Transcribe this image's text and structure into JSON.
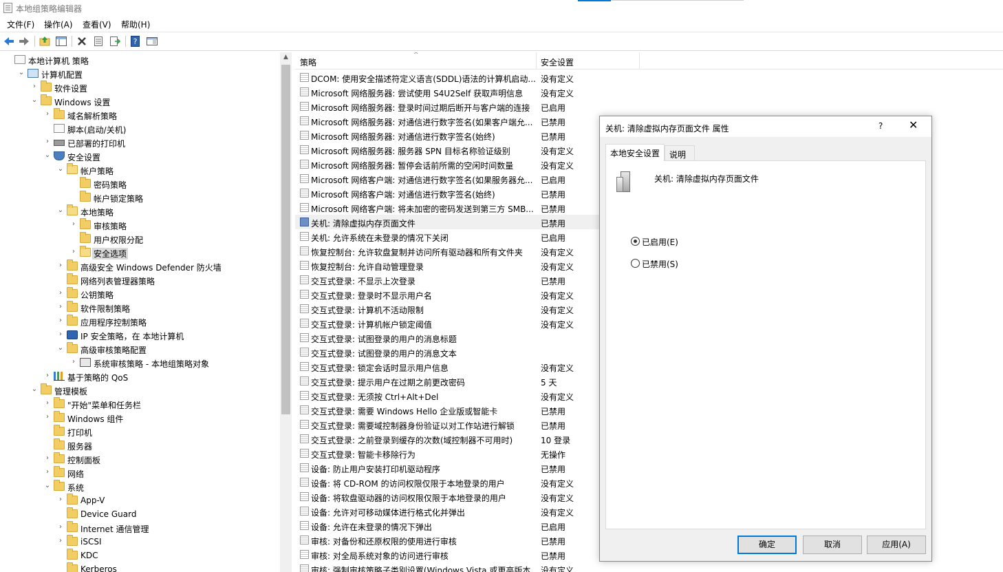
{
  "window": {
    "title": "本地组策略编辑器"
  },
  "menu": [
    "文件(F)",
    "操作(A)",
    "查看(V)",
    "帮助(H)"
  ],
  "toolbar": {
    "icons": [
      "back-icon",
      "forward-icon",
      "up-folder-icon",
      "show-hide-tree-icon",
      "delete-icon",
      "properties-icon",
      "export-list-icon",
      "help-icon",
      "view-icon"
    ]
  },
  "tree": {
    "items": [
      {
        "label": "本地计算机 策略",
        "level": 0,
        "icon": "doc",
        "toggle": ""
      },
      {
        "label": "计算机配置",
        "level": 1,
        "icon": "pc",
        "toggle": "v"
      },
      {
        "label": "软件设置",
        "level": 2,
        "icon": "folder",
        "toggle": ">"
      },
      {
        "label": "Windows 设置",
        "level": 2,
        "icon": "folder",
        "toggle": "v"
      },
      {
        "label": "域名解析策略",
        "level": 3,
        "icon": "folder",
        "toggle": ">"
      },
      {
        "label": "脚本(启动/关机)",
        "level": 3,
        "icon": "doc",
        "toggle": ""
      },
      {
        "label": "已部署的打印机",
        "level": 3,
        "icon": "printer",
        "toggle": ">"
      },
      {
        "label": "安全设置",
        "level": 3,
        "icon": "shield",
        "toggle": "v"
      },
      {
        "label": "帐户策略",
        "level": 4,
        "icon": "folder-open",
        "toggle": "v"
      },
      {
        "label": "密码策略",
        "level": 5,
        "icon": "folder",
        "toggle": ""
      },
      {
        "label": "帐户锁定策略",
        "level": 5,
        "icon": "folder",
        "toggle": ""
      },
      {
        "label": "本地策略",
        "level": 4,
        "icon": "folder-open",
        "toggle": "v"
      },
      {
        "label": "审核策略",
        "level": 5,
        "icon": "folder",
        "toggle": ">"
      },
      {
        "label": "用户权限分配",
        "level": 5,
        "icon": "folder",
        "toggle": ""
      },
      {
        "label": "安全选项",
        "level": 5,
        "icon": "folder-open",
        "toggle": ">",
        "selected": true
      },
      {
        "label": "高级安全 Windows Defender 防火墙",
        "level": 4,
        "icon": "folder",
        "toggle": ">"
      },
      {
        "label": "网络列表管理器策略",
        "level": 4,
        "icon": "folder",
        "toggle": ""
      },
      {
        "label": "公钥策略",
        "level": 4,
        "icon": "folder",
        "toggle": ">"
      },
      {
        "label": "软件限制策略",
        "level": 4,
        "icon": "folder",
        "toggle": ">"
      },
      {
        "label": "应用程序控制策略",
        "level": 4,
        "icon": "folder",
        "toggle": ">"
      },
      {
        "label": "IP 安全策略，在 本地计算机",
        "level": 4,
        "icon": "ip",
        "toggle": ">"
      },
      {
        "label": "高级审核策略配置",
        "level": 4,
        "icon": "folder",
        "toggle": "v"
      },
      {
        "label": "系统审核策略 - 本地组策略对象",
        "level": 5,
        "icon": "audit",
        "toggle": ">"
      },
      {
        "label": "基于策略的 QoS",
        "level": 3,
        "icon": "chart",
        "toggle": ">"
      },
      {
        "label": "管理模板",
        "level": 2,
        "icon": "folder",
        "toggle": "v"
      },
      {
        "label": "\"开始\"菜单和任务栏",
        "level": 3,
        "icon": "folder",
        "toggle": ">"
      },
      {
        "label": "Windows 组件",
        "level": 3,
        "icon": "folder",
        "toggle": ">"
      },
      {
        "label": "打印机",
        "level": 3,
        "icon": "folder",
        "toggle": ""
      },
      {
        "label": "服务器",
        "level": 3,
        "icon": "folder",
        "toggle": ""
      },
      {
        "label": "控制面板",
        "level": 3,
        "icon": "folder",
        "toggle": ">"
      },
      {
        "label": "网络",
        "level": 3,
        "icon": "folder",
        "toggle": ">"
      },
      {
        "label": "系统",
        "level": 3,
        "icon": "folder",
        "toggle": "v"
      },
      {
        "label": "App-V",
        "level": 4,
        "icon": "folder",
        "toggle": ">"
      },
      {
        "label": "Device Guard",
        "level": 4,
        "icon": "folder",
        "toggle": ""
      },
      {
        "label": "Internet 通信管理",
        "level": 4,
        "icon": "folder",
        "toggle": ">"
      },
      {
        "label": "iSCSI",
        "level": 4,
        "icon": "folder",
        "toggle": ">"
      },
      {
        "label": "KDC",
        "level": 4,
        "icon": "folder",
        "toggle": ""
      },
      {
        "label": "Kerberos",
        "level": 4,
        "icon": "folder",
        "toggle": ""
      }
    ]
  },
  "list": {
    "columns": [
      "策略",
      "安全设置"
    ],
    "rows": [
      {
        "name": "DCOM: 使用安全描述符定义语言(SDDL)语法的计算机启动...",
        "value": "没有定义"
      },
      {
        "name": "Microsoft 网络服务器: 尝试使用 S4U2Self 获取声明信息",
        "value": "没有定义"
      },
      {
        "name": "Microsoft 网络服务器: 登录时间过期后断开与客户端的连接",
        "value": "已启用"
      },
      {
        "name": "Microsoft 网络服务器: 对通信进行数字签名(如果客户端允...",
        "value": "已禁用"
      },
      {
        "name": "Microsoft 网络服务器: 对通信进行数字签名(始终)",
        "value": "已禁用"
      },
      {
        "name": "Microsoft 网络服务器: 服务器 SPN 目标名称验证级别",
        "value": "没有定义"
      },
      {
        "name": "Microsoft 网络服务器: 暂停会话前所需的空闲时间数量",
        "value": "没有定义"
      },
      {
        "name": "Microsoft 网络客户端: 对通信进行数字签名(如果服务器允...",
        "value": "已启用"
      },
      {
        "name": "Microsoft 网络客户端: 对通信进行数字签名(始终)",
        "value": "已禁用"
      },
      {
        "name": "Microsoft 网络客户端: 将未加密的密码发送到第三方 SMB...",
        "value": "已禁用"
      },
      {
        "name": "关机: 清除虚拟内存页面文件",
        "value": "已禁用",
        "highlight": true
      },
      {
        "name": "关机: 允许系统在未登录的情况下关闭",
        "value": "已启用"
      },
      {
        "name": "恢复控制台: 允许软盘复制并访问所有驱动器和所有文件夹",
        "value": "没有定义"
      },
      {
        "name": "恢复控制台: 允许自动管理登录",
        "value": "没有定义"
      },
      {
        "name": "交互式登录: 不显示上次登录",
        "value": "已禁用"
      },
      {
        "name": "交互式登录: 登录时不显示用户名",
        "value": "没有定义"
      },
      {
        "name": "交互式登录: 计算机不活动限制",
        "value": "没有定义"
      },
      {
        "name": "交互式登录: 计算机帐户锁定阈值",
        "value": "没有定义"
      },
      {
        "name": "交互式登录: 试图登录的用户的消息标题",
        "value": ""
      },
      {
        "name": "交互式登录: 试图登录的用户的消息文本",
        "value": ""
      },
      {
        "name": "交互式登录: 锁定会话时显示用户信息",
        "value": "没有定义"
      },
      {
        "name": "交互式登录: 提示用户在过期之前更改密码",
        "value": "5 天"
      },
      {
        "name": "交互式登录: 无须按 Ctrl+Alt+Del",
        "value": "没有定义"
      },
      {
        "name": "交互式登录: 需要 Windows Hello 企业版或智能卡",
        "value": "已禁用"
      },
      {
        "name": "交互式登录: 需要域控制器身份验证以对工作站进行解锁",
        "value": "已禁用"
      },
      {
        "name": "交互式登录: 之前登录到缓存的次数(域控制器不可用时)",
        "value": "10 登录"
      },
      {
        "name": "交互式登录: 智能卡移除行为",
        "value": "无操作"
      },
      {
        "name": "设备: 防止用户安装打印机驱动程序",
        "value": "已禁用"
      },
      {
        "name": "设备: 将 CD-ROM 的访问权限仅限于本地登录的用户",
        "value": "没有定义"
      },
      {
        "name": "设备: 将软盘驱动器的访问权限仅限于本地登录的用户",
        "value": "没有定义"
      },
      {
        "name": "设备: 允许对可移动媒体进行格式化并弹出",
        "value": "没有定义"
      },
      {
        "name": "设备: 允许在未登录的情况下弹出",
        "value": "已启用"
      },
      {
        "name": "审核: 对备份和还原权限的使用进行审核",
        "value": "已禁用"
      },
      {
        "name": "审核: 对全局系统对象的访问进行审核",
        "value": "已禁用"
      },
      {
        "name": "审核: 强制审核策略子类别设置(Windows Vista 或更高版本...",
        "value": "没有定义"
      }
    ]
  },
  "dialog": {
    "title": "关机: 清除虚拟内存页面文件 属性",
    "help": "?",
    "close": "✕",
    "tabs": [
      "本地安全设置",
      "说明"
    ],
    "policy_name": "关机: 清除虚拟内存页面文件",
    "options": [
      {
        "label": "已启用(E)",
        "checked": true
      },
      {
        "label": "已禁用(S)",
        "checked": false
      }
    ],
    "buttons": {
      "ok": "确定",
      "cancel": "取消",
      "apply": "应用(A)"
    }
  }
}
